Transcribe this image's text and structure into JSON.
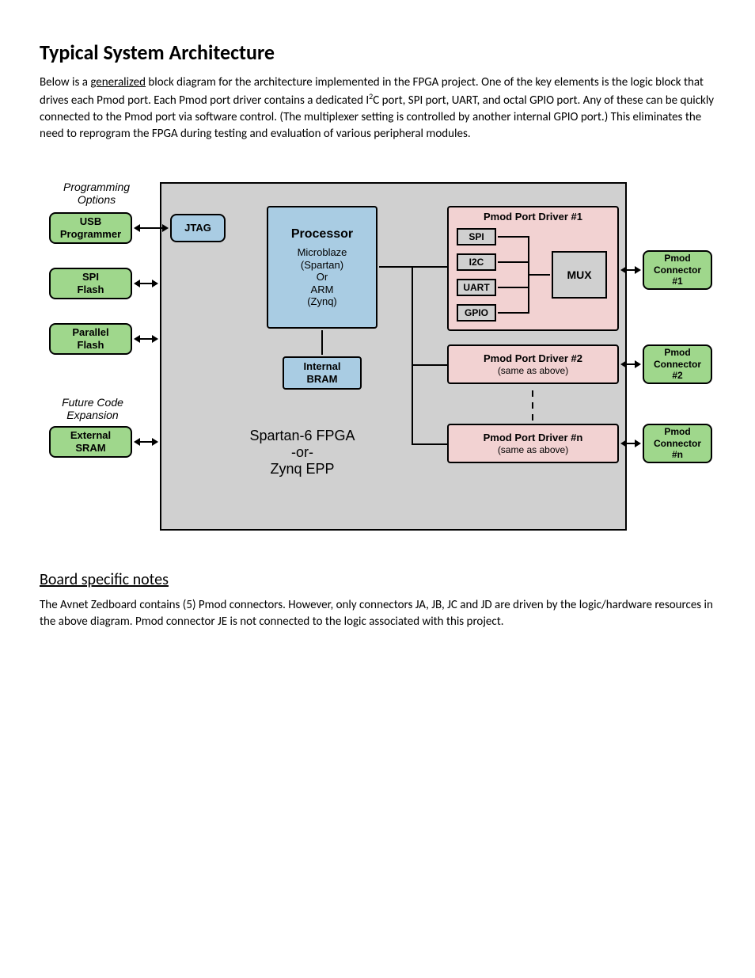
{
  "title": "Typical System Architecture",
  "intro_parts": {
    "p1": "Below is a ",
    "generalized": "generalized",
    "p2": " block diagram for the architecture implemented in the FPGA project. One of the key elements is the logic block that drives each Pmod port. Each Pmod port driver contains a dedicated I",
    "sup": "2",
    "p3": "C port, SPI port, UART, and octal GPIO port. Any of these can be quickly connected to the Pmod port via software control. (The multiplexer setting is controlled by another internal GPIO port.) This eliminates the need to reprogram the FPGA during testing and evaluation of various peripheral modules."
  },
  "diagram": {
    "prog_options": "Programming\nOptions",
    "usb_programmer": "USB\nProgrammer",
    "spi_flash": "SPI\nFlash",
    "parallel_flash": "Parallel\nFlash",
    "future_code": "Future Code\nExpansion",
    "external_sram": "External\nSRAM",
    "jtag": "JTAG",
    "processor_title": "Processor",
    "processor_body": "Microblaze\n(Spartan)\nOr\nARM\n(Zynq)",
    "internal_bram": "Internal\nBRAM",
    "fpga_caption": "Spartan-6 FPGA\n-or-\nZynq EPP",
    "driver1_title": "Pmod Port Driver #1",
    "spi": "SPI",
    "i2c": "I2C",
    "uart": "UART",
    "gpio": "GPIO",
    "mux": "MUX",
    "driver2_title": "Pmod Port Driver #2",
    "same_as_above": "(same as above)",
    "drivern_title": "Pmod Port Driver #n",
    "pmod_conn1": "Pmod\nConnector\n#1",
    "pmod_conn2": "Pmod\nConnector\n#2",
    "pmod_connn": "Pmod\nConnector\n#n"
  },
  "notes_heading": "Board specific notes",
  "notes_body": "The Avnet Zedboard contains (5) Pmod connectors.  However, only connectors JA, JB, JC and JD are driven by the logic/hardware resources in the above diagram.   Pmod connector JE is not connected to the logic associated with this project."
}
